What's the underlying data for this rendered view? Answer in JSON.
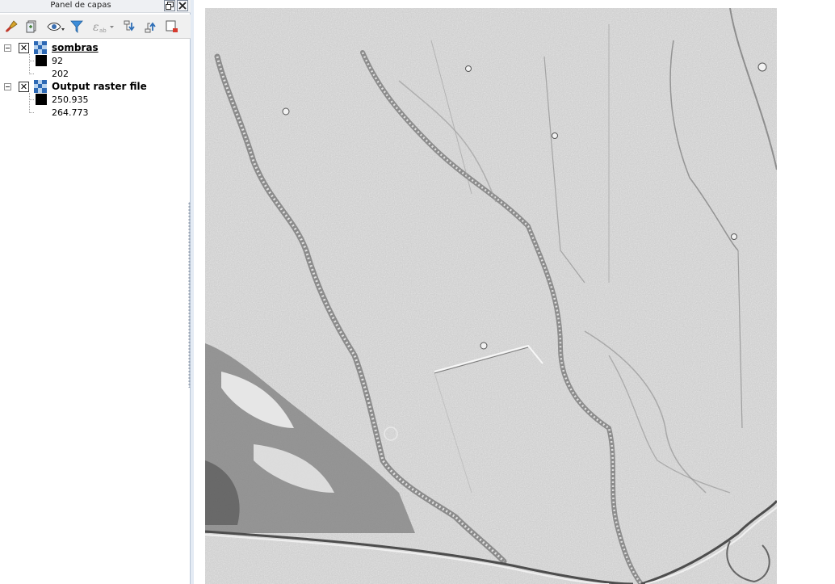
{
  "panel": {
    "title": "Panel de capas"
  },
  "toolbar": {
    "buttons": [
      {
        "icon": "style-brush-icon",
        "label": "Open layer styling"
      },
      {
        "icon": "add-group-icon",
        "label": "Add group"
      },
      {
        "icon": "eye-visibility-icon",
        "label": "Manage map themes"
      },
      {
        "icon": "filter-icon",
        "label": "Filter legend"
      },
      {
        "icon": "expression-filter-icon",
        "label": "Filter legend by expression"
      },
      {
        "icon": "expand-all-icon",
        "label": "Expand all"
      },
      {
        "icon": "collapse-all-icon",
        "label": "Collapse all"
      },
      {
        "icon": "remove-layer-icon",
        "label": "Remove layer"
      }
    ]
  },
  "layers": [
    {
      "name": "sombras",
      "visible": true,
      "selected": true,
      "legend": [
        {
          "label": "92",
          "color": "#000000"
        },
        {
          "label": "202",
          "color": null
        }
      ]
    },
    {
      "name": "Output raster file",
      "visible": true,
      "selected": false,
      "legend": [
        {
          "label": "250.935",
          "color": "#000000"
        },
        {
          "label": "264.773",
          "color": null
        }
      ]
    }
  ],
  "map": {
    "background": "#ffffff",
    "raster_base_color": "#c8c8c8"
  }
}
